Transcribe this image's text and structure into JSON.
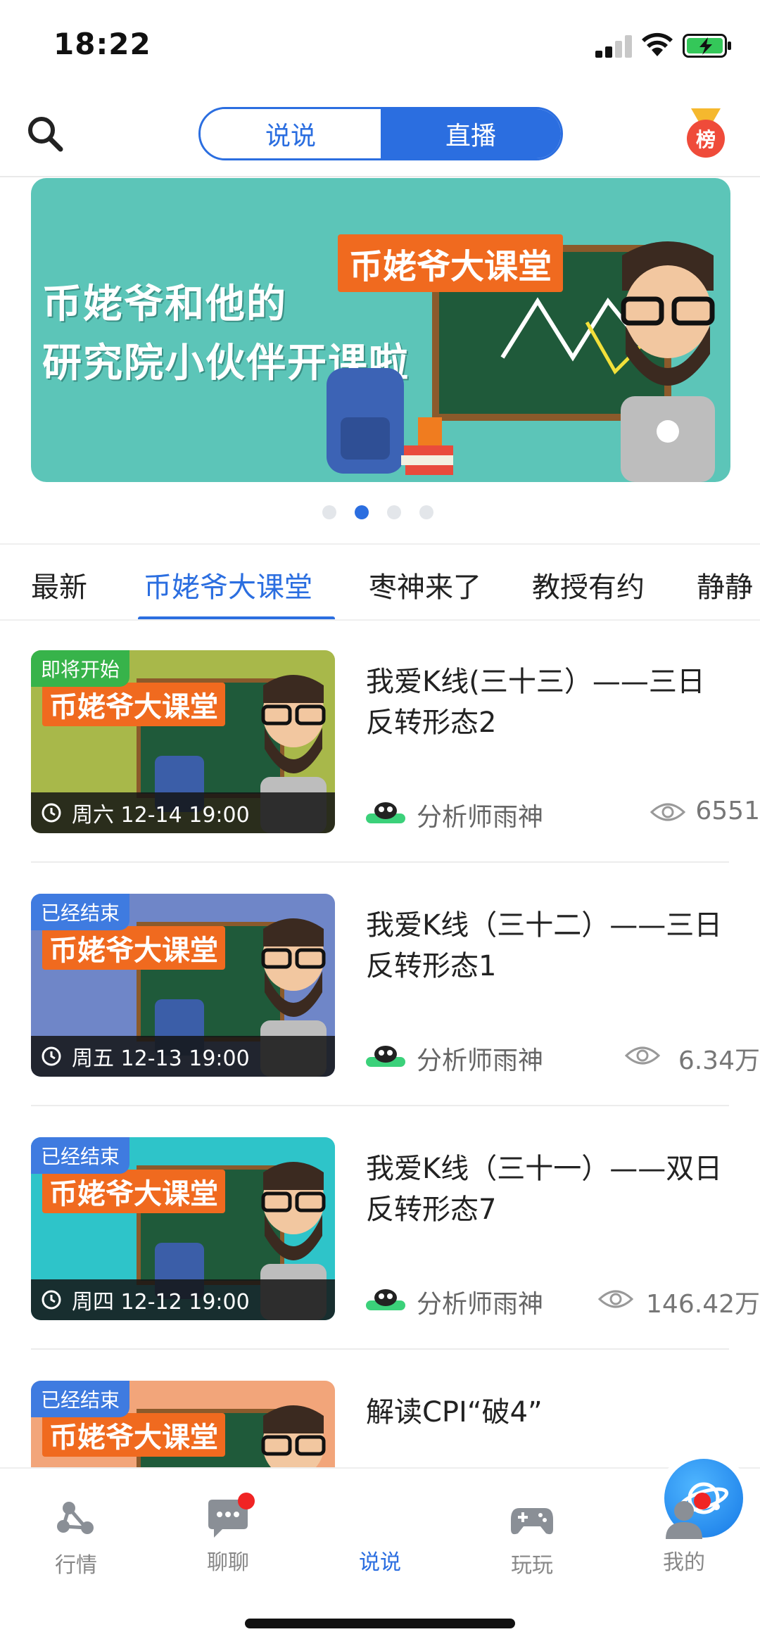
{
  "status_bar": {
    "time": "18:22"
  },
  "header": {
    "tabs": [
      {
        "label": "说说",
        "active": false
      },
      {
        "label": "直播",
        "active": true
      }
    ],
    "rank_label": "榜"
  },
  "banner": {
    "line1": "币姥爷和他的",
    "line2": "研究院小伙伴开课啦",
    "board_label": "币姥爷大课堂",
    "pages": 4,
    "active_page": 2
  },
  "category_tabs": [
    {
      "label": "最新",
      "active": false
    },
    {
      "label": "币姥爷大课堂",
      "active": true
    },
    {
      "label": "枣神来了",
      "active": false
    },
    {
      "label": "教授有约",
      "active": false
    },
    {
      "label": "静静",
      "active": false
    }
  ],
  "items": [
    {
      "status": "即将开始",
      "status_color": "#37b34a",
      "thumb_bg": "#a8b84a",
      "thumb_title": "币姥爷大课堂",
      "time": "周六 12-14 19:00",
      "title": "我爱K线(三十三）——三日反转形态2",
      "author": "分析师雨神",
      "views": "6551"
    },
    {
      "status": "已经结束",
      "status_color": "#3f7be0",
      "thumb_bg": "#6f86c8",
      "thumb_title": "币姥爷大课堂",
      "time": "周五 12-13 19:00",
      "title": "我爱K线（三十二）——三日反转形态1",
      "author": "分析师雨神",
      "views": "6.34万"
    },
    {
      "status": "已经结束",
      "status_color": "#3f7be0",
      "thumb_bg": "#2ec4c9",
      "thumb_title": "币姥爷大课堂",
      "time": "周四 12-12 19:00",
      "title": "我爱K线（三十一）——双日反转形态7",
      "author": "分析师雨神",
      "views": "146.42万"
    },
    {
      "status": "已经结束",
      "status_color": "#3f7be0",
      "thumb_bg": "#f2a57a",
      "thumb_title": "币姥爷大课堂",
      "time": "",
      "title": "解读CPI“破4”",
      "author": "",
      "views": ""
    }
  ],
  "bottom_nav": [
    {
      "label": "行情",
      "icon": "market-icon",
      "badge": false,
      "active": false
    },
    {
      "label": "聊聊",
      "icon": "chat-icon",
      "badge": true,
      "active": false
    },
    {
      "label": "说说",
      "icon": "planet-icon",
      "badge": false,
      "active": true
    },
    {
      "label": "玩玩",
      "icon": "gamepad-icon",
      "badge": false,
      "active": false
    },
    {
      "label": "我的",
      "icon": "profile-icon",
      "badge": true,
      "active": false
    }
  ],
  "colors": {
    "accent": "#2b6ee0",
    "badge_red": "#f02424"
  }
}
